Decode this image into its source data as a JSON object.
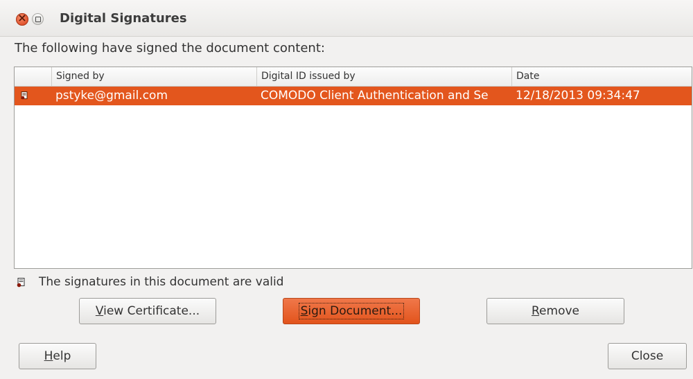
{
  "window": {
    "title": "Digital Signatures"
  },
  "heading": "The following have signed the document content:",
  "table": {
    "columns": [
      "",
      "Signed by",
      "Digital ID issued by",
      "Date"
    ],
    "rows": [
      {
        "icon": "signature-certificate-icon",
        "signed_by": "pstyke@gmail.com",
        "issued_by": "COMODO Client Authentication and Se",
        "date": "12/18/2013 09:34:47",
        "selected": true
      }
    ]
  },
  "status": {
    "icon": "signature-valid-icon",
    "text": "The signatures in this document are valid"
  },
  "buttons": {
    "view_certificate": {
      "accel": "V",
      "rest": "iew Certificate..."
    },
    "sign_document": {
      "accel": "S",
      "rest": "ign Document..."
    },
    "remove": {
      "accel": "R",
      "rest": "emove"
    },
    "help": {
      "accel": "H",
      "rest": "elp"
    },
    "close": "Close"
  },
  "colors": {
    "selection": "#e3561d",
    "window_bg": "#f2f1f0"
  }
}
